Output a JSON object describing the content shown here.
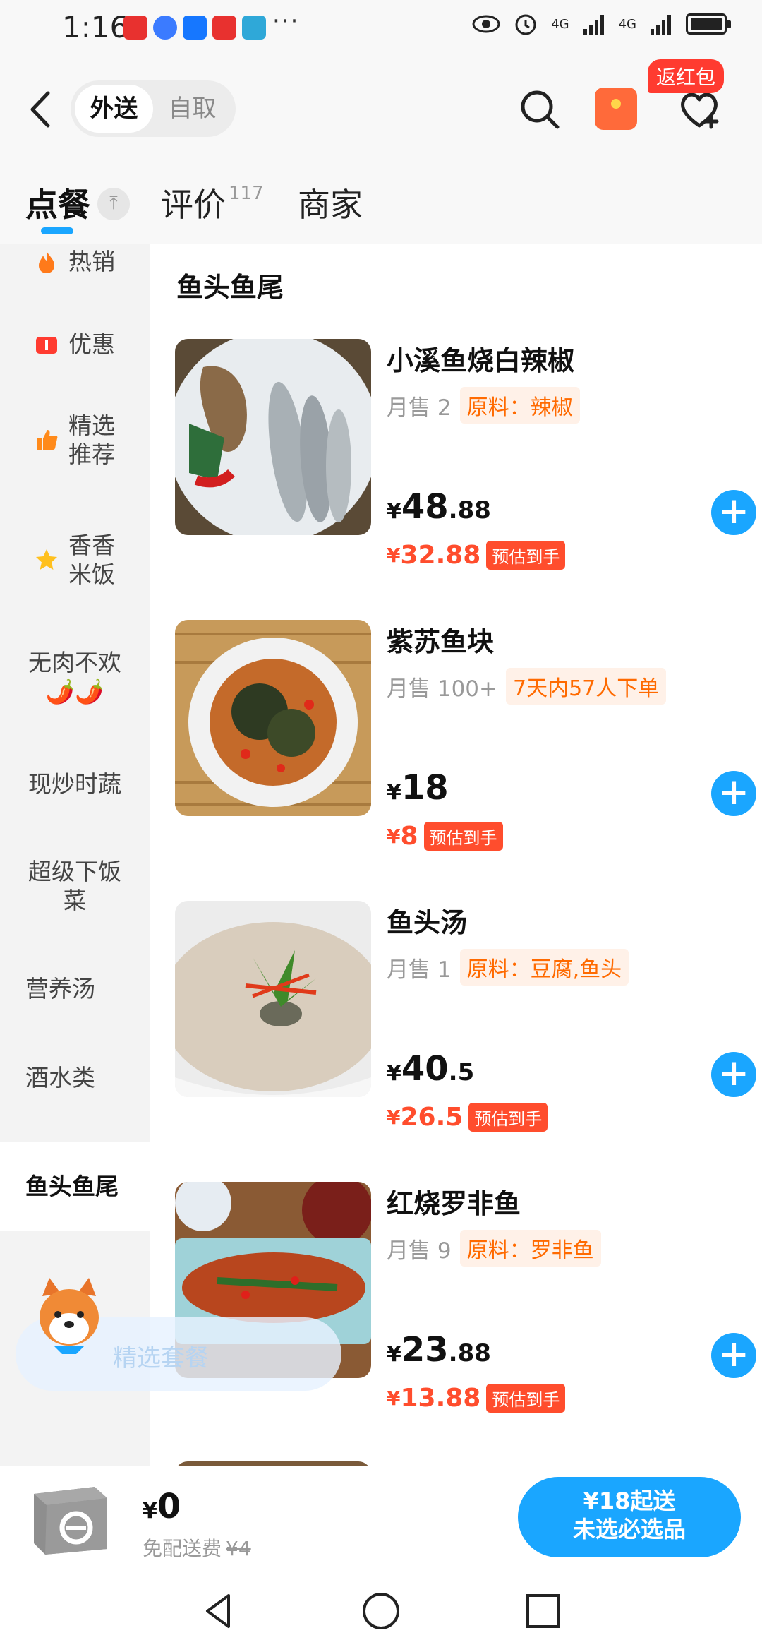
{
  "status_bar": {
    "time": "1:16",
    "dots": "···",
    "net1": "4G",
    "net2": "4G"
  },
  "header": {
    "segment": [
      "外送",
      "自取"
    ],
    "favorite_badge": "返红包"
  },
  "tabs": [
    {
      "label": "点餐"
    },
    {
      "label": "评价",
      "count": "117"
    },
    {
      "label": "商家"
    }
  ],
  "sidebar": {
    "items": [
      {
        "label": "热销",
        "icon": "fire-icon"
      },
      {
        "label": "优惠",
        "icon": "coupon-icon"
      },
      {
        "label": "精选推荐",
        "line1": "精选",
        "line2": "推荐",
        "icon": "thumbs-up-icon"
      },
      {
        "label": "香香米饭",
        "line1": "香香",
        "line2": "米饭",
        "icon": "star-icon"
      },
      {
        "label": "无肉不欢🌶️🌶️",
        "line1": "无肉不欢",
        "line2": "🌶️🌶️"
      },
      {
        "label": "现炒时蔬"
      },
      {
        "label": "超级下饭菜",
        "line1": "超级下饭",
        "line2": "菜"
      },
      {
        "label": "营养汤"
      },
      {
        "label": "酒水类"
      },
      {
        "label": "鱼头鱼尾"
      }
    ],
    "active": "鱼头鱼尾"
  },
  "section_title": "鱼头鱼尾",
  "dishes": [
    {
      "name": "小溪鱼烧白辣椒",
      "sales": "月售 2",
      "tag": "原料：辣椒",
      "price_int": "48",
      "price_dec": ".88",
      "est_price": "32.88",
      "est_label": "预估到手"
    },
    {
      "name": "紫苏鱼块",
      "sales": "月售 100+",
      "tag": "7天内57人下单",
      "price_int": "18",
      "price_dec": "",
      "est_price": "8",
      "est_label": "预估到手"
    },
    {
      "name": "鱼头汤",
      "sales": "月售 1",
      "tag": "原料：豆腐,鱼头",
      "price_int": "40",
      "price_dec": ".5",
      "est_price": "26.5",
      "est_label": "预估到手"
    },
    {
      "name": "红烧罗非鱼",
      "sales": "月售 9",
      "tag": "原料：罗非鱼",
      "price_int": "23",
      "price_dec": ".88",
      "est_price": "13.88",
      "est_label": "预估到手"
    }
  ],
  "promo": {
    "label": "精选套餐"
  },
  "cart": {
    "currency": "¥",
    "total": "0",
    "fee_label": "免配送费",
    "fee_old": "¥4",
    "checkout_line1": "¥18起送",
    "checkout_line2": "未选必选品"
  },
  "currency": "¥",
  "colors": {
    "accent": "#1aa6ff",
    "price_red": "#ff4d2d",
    "tag_orange": "#ff6a00"
  }
}
